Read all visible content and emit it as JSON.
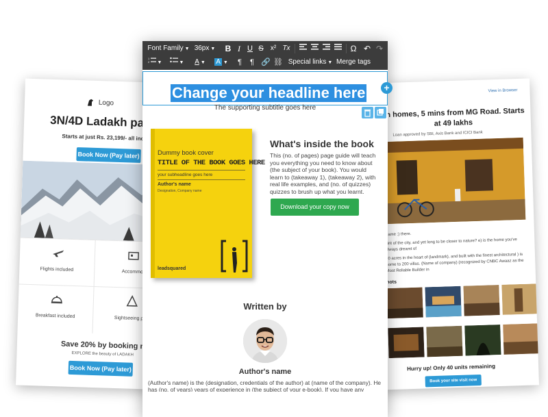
{
  "left_card": {
    "logo": "Logo",
    "title": "3N/4D Ladakh pack",
    "price_line": "Starts at just Rs. 23,199/- all inclu",
    "book_btn": "Book Now (Pay later)",
    "features": [
      {
        "label": "Flights included",
        "icon": "flight-icon"
      },
      {
        "label": "Accommo",
        "icon": "hotel-icon"
      },
      {
        "label": "Breakfast included",
        "icon": "cloche-icon"
      },
      {
        "label": "Sightseeing per",
        "icon": "sightseeing-icon"
      }
    ],
    "save_line": "Save 20% by booking no",
    "explore_line": "EXPLORE the beauty of LADAKH",
    "book_btn2": "Book Now (Pay later)"
  },
  "right_card": {
    "view_browser": "View in Browser",
    "title": "en homes, 5 mins from MG Road. Starts at 49 lakhs",
    "subtitle": "Loan approved by SBI, Axis Bank and ICICI Bank",
    "para1": "Name :) there.",
    "para2": "pirit of the city, and yet long to be closer to nature? e) is the home you've always dreamt of",
    "para3": "40 acres in the heart of (landmark), and built with the finest architectural ) is home to 200 villas. (Name of company) (recognized by CNBC Awaaz as the Most Reliable Builder in",
    "shots_label": "hots",
    "hurry": "Hurry up! Only 40 units remaining",
    "book_btn": "Book your site visit now"
  },
  "toolbar": {
    "font_family": "Font Family",
    "font_size": "36px",
    "bold": "B",
    "italic": "I",
    "underline": "U",
    "strike": "S",
    "superscript": "x²",
    "clear_format": "Tx",
    "omega": "Ω",
    "special_links": "Special links",
    "merge_tags": "Merge tags"
  },
  "editor": {
    "headline": "Change your headline here",
    "subtitle": "The supporting subtitle goes here",
    "book": {
      "line1": "Dummy book cover",
      "line2": "TITLE OF THE BOOK GOES HERE",
      "line3": "your subheadline goes here",
      "line4": "Author's name",
      "line5": "Designation, Company name",
      "brand": "leadsquared"
    },
    "inside_title": "What's inside the book",
    "inside_text": "This (no. of pages) page guide will teach you everything you need to know about (the subject of your book). You would learn to (takeaway 1), (takeaway 2), with real life examples, and (no. of quizzes) quizzes to brush up what you learnt.",
    "download_btn": "Download your copy now",
    "written_by": "Written by",
    "author_name": "Author's name",
    "author_desc": "(Author's name) is the (designation, credentials of the author) at (name of the company). He has (no. of years) years of experience in (the subject of your e-book). If you have any"
  },
  "colors": {
    "accent_blue": "#2d9ad6",
    "toolbar_bg": "#3c3c3c",
    "book_yellow": "#f5d20e",
    "download_green": "#2ea84f"
  }
}
